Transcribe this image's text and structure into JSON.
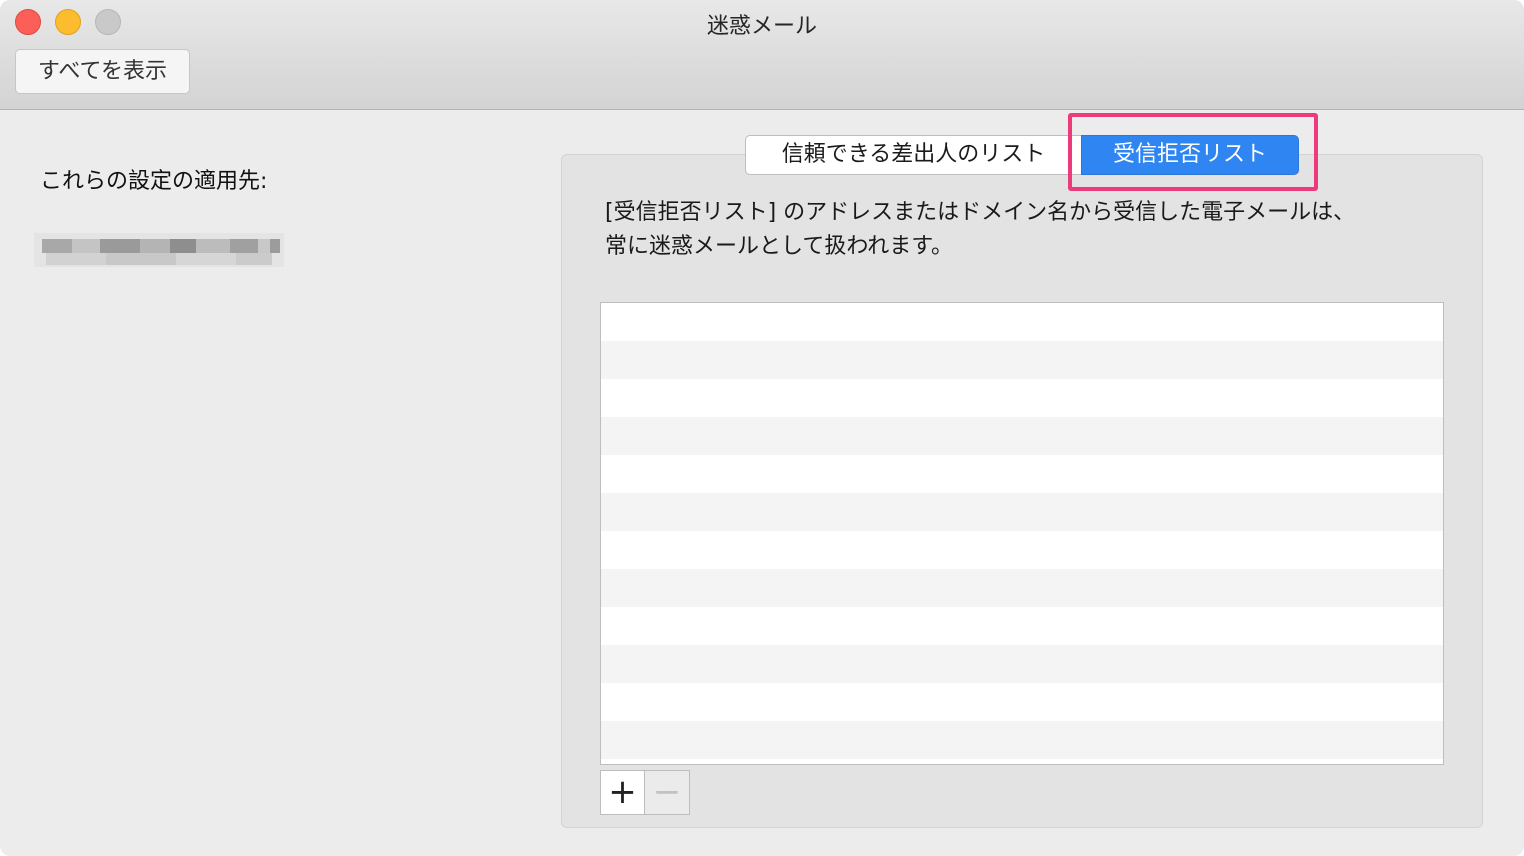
{
  "window": {
    "title": "迷惑メール"
  },
  "toolbar": {
    "show_all_label": "すべてを表示"
  },
  "sidebar": {
    "applies_to_label": "これらの設定の適用先:"
  },
  "tabs": {
    "items": [
      {
        "label": "信頼できる差出人のリスト",
        "selected": false
      },
      {
        "label": "受信拒否リスト",
        "selected": true
      }
    ]
  },
  "main": {
    "description_line1": "[受信拒否リスト] のアドレスまたはドメイン名から受信した電子メールは、",
    "description_line2": "常に迷惑メールとして扱われます。"
  },
  "list_controls": {
    "add_label": "+",
    "remove_label": "−"
  },
  "colors": {
    "accent": "#2f86f2",
    "highlight": "#ec3a7a",
    "close": "#fc5f57",
    "minimize": "#fdbc2e"
  }
}
